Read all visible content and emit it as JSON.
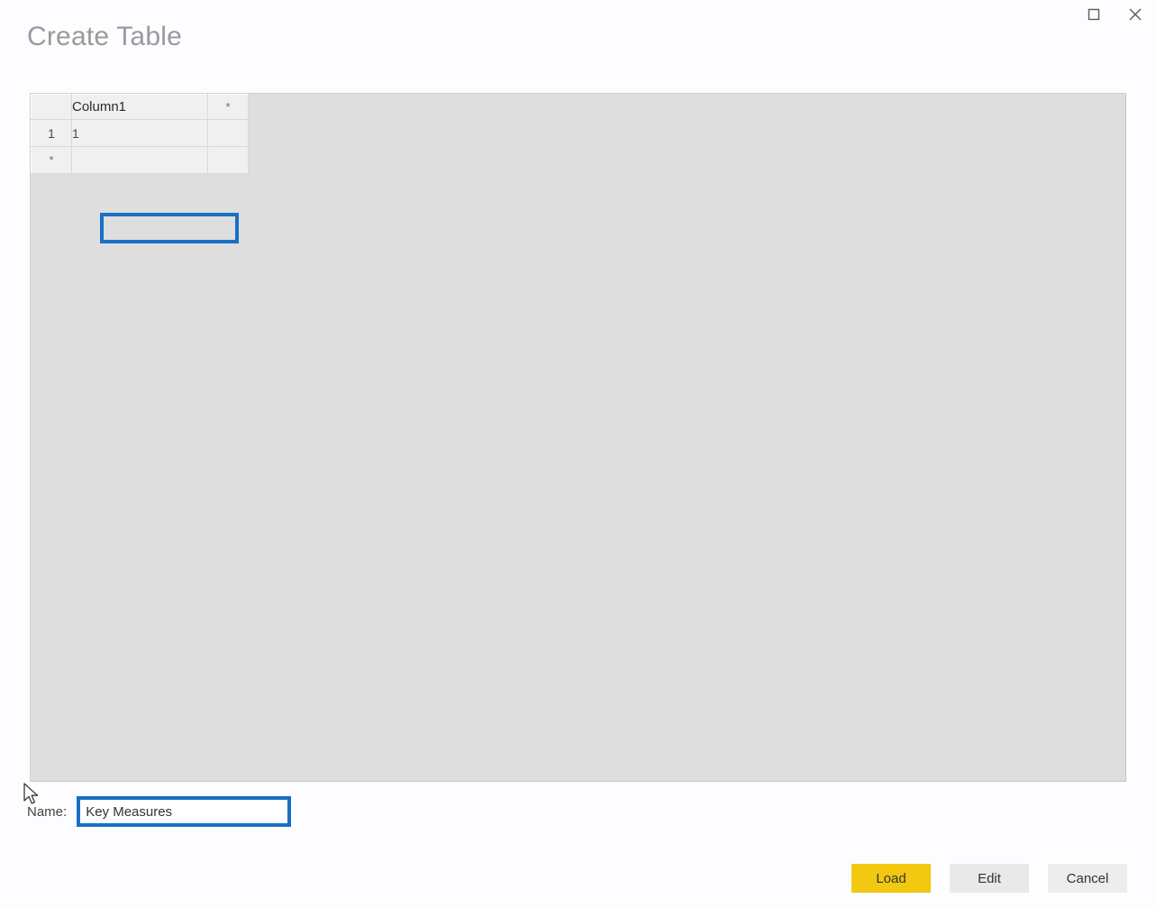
{
  "window": {
    "maximize_icon": "square-icon",
    "close_icon": "close-icon"
  },
  "dialog": {
    "title": "Create Table"
  },
  "grid": {
    "columns": [
      "",
      "Column1",
      "*"
    ],
    "rows": [
      {
        "header": "1",
        "value": "1",
        "star": ""
      },
      {
        "header": "*",
        "value": "",
        "star": ""
      }
    ],
    "selected_cell": {
      "row": 0,
      "column": "Column1",
      "value": "1"
    }
  },
  "name_field": {
    "label": "Name:",
    "value": "Key Measures",
    "placeholder": ""
  },
  "footer": {
    "load_label": "Load",
    "edit_label": "Edit",
    "cancel_label": "Cancel"
  },
  "colors": {
    "accent_yellow": "#f2c811",
    "selection_blue": "#1a6fc4",
    "panel_gray": "#dedede",
    "title_gray": "#9a9a9e"
  }
}
